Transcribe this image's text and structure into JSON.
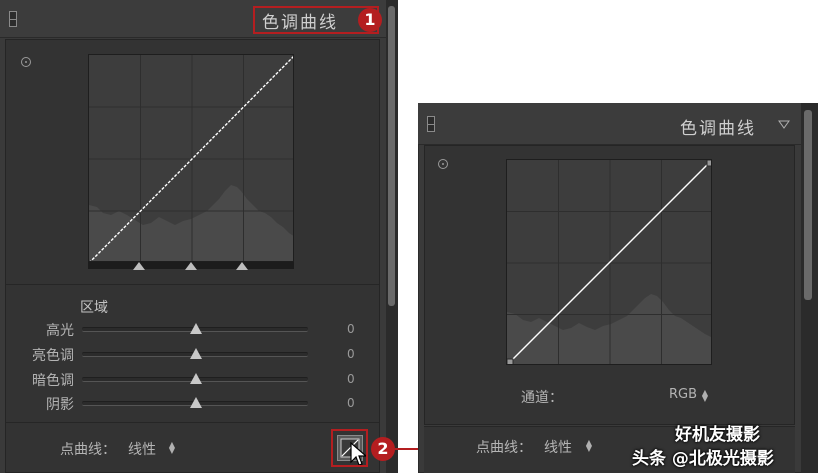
{
  "left_panel": {
    "title": "色调曲线",
    "region_heading": "区域",
    "sliders": [
      {
        "label": "高光",
        "value": "0",
        "level": 0.5
      },
      {
        "label": "亮色调",
        "value": "0",
        "level": 0.5
      },
      {
        "label": "暗色调",
        "value": "0",
        "level": 0.5
      },
      {
        "label": "阴影",
        "value": "0",
        "level": 0.5
      }
    ],
    "point_curve_label": "点曲线：",
    "point_curve_value": "线性",
    "icons": [
      "panel-grip-icon",
      "target-adjust-icon",
      "split-handle-icon",
      "updown-arrows-icon",
      "point-curve-edit-icon",
      "mouse-cursor-icon"
    ]
  },
  "right_panel": {
    "title": "色调曲线",
    "channel_label": "通道：",
    "channel_value": "RGB",
    "point_curve_label": "点曲线：",
    "point_curve_value": "线性",
    "icons": [
      "panel-grip-icon",
      "collapse-triangle-icon",
      "target-adjust-icon",
      "updown-arrows-icon"
    ]
  },
  "callouts": {
    "one": "1",
    "two": "2",
    "color": "#b41e20"
  },
  "watermark": {
    "line1": "好机友摄影",
    "line2": "头条 @北极光摄影"
  },
  "colors": {
    "panel_bg": "#3a3a3a",
    "curve_bg": "#3d3d3d",
    "histogram": "#4a4a4a",
    "curve_line": "#ffffff"
  }
}
